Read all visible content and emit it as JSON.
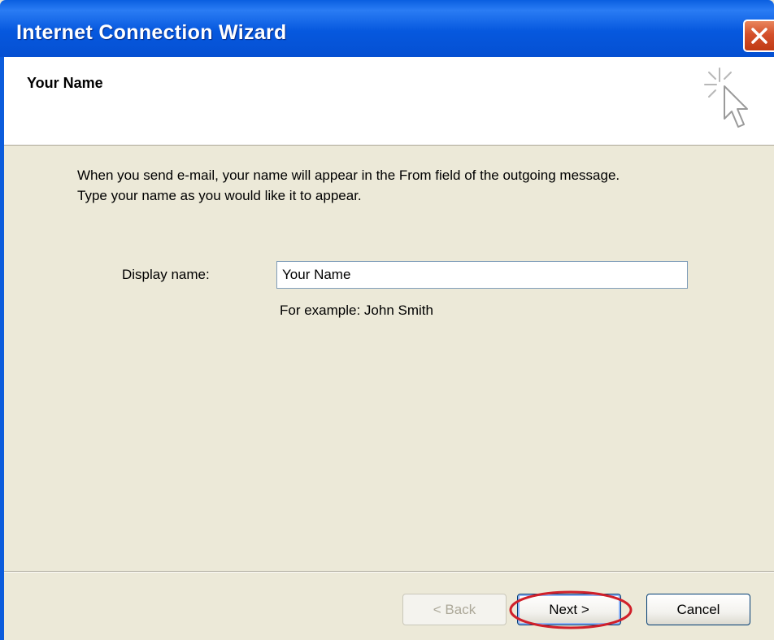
{
  "window": {
    "title": "Internet Connection Wizard"
  },
  "header": {
    "title": "Your Name",
    "icon": "wizard-sparkle-cursor-icon"
  },
  "body": {
    "description_line1": "When you send e-mail, your name will appear in the From field of the outgoing message.",
    "description_line2": "Type your name as you would like it to appear.",
    "display_name_label": "Display name:",
    "display_name_value": "Your Name",
    "example_hint": "For example: John Smith"
  },
  "buttons": {
    "back_label": "< Back",
    "next_label": "Next >",
    "cancel_label": "Cancel"
  },
  "colors": {
    "titlebar": "#0658de",
    "dialog_background": "#ece9d8",
    "highlight_ellipse": "#d0202a"
  }
}
